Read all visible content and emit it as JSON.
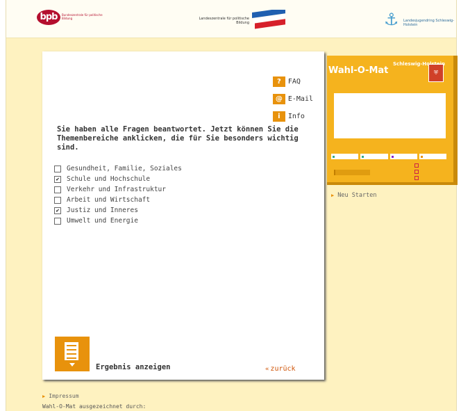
{
  "header": {
    "bpb_logo": "bpb",
    "bpb_subtitle": "Bundeszentrale für politische Bildung",
    "lz_text": "Landeszentrale für politische Bildung",
    "ljr_text": "Landesjugendring Schleswig-Holstein"
  },
  "menu": [
    {
      "icon": "?",
      "label": "FAQ"
    },
    {
      "icon": "@",
      "label": "E-Mail"
    },
    {
      "icon": "i",
      "label": "Info"
    }
  ],
  "prompt": "Sie haben alle Fragen beantwortet. Jetzt können Sie die Themenbereiche anklicken, die für Sie besonders wichtig sind.",
  "topics": [
    {
      "label": "Gesundheit, Familie, Soziales",
      "checked": false
    },
    {
      "label": "Schule und Hochschule",
      "checked": true
    },
    {
      "label": "Verkehr und Infrastruktur",
      "checked": false
    },
    {
      "label": "Arbeit und Wirtschaft",
      "checked": false
    },
    {
      "label": "Justiz und Inneres",
      "checked": true
    },
    {
      "label": "Umwelt und Energie",
      "checked": false
    }
  ],
  "result_label": "Ergebnis anzeigen",
  "back_label": "zurück",
  "widget": {
    "title": "Wahl-O-Mat",
    "state": "Schleswig-Holstein"
  },
  "side": {
    "neu_starten": "Neu Starten"
  },
  "footer": {
    "impressum": "Impressum",
    "award": "Wahl-O-Mat ausgezeichnet durch:"
  },
  "colors": {
    "accent": "#e8920c",
    "background": "#fef2c0",
    "link": "#d0560a"
  }
}
